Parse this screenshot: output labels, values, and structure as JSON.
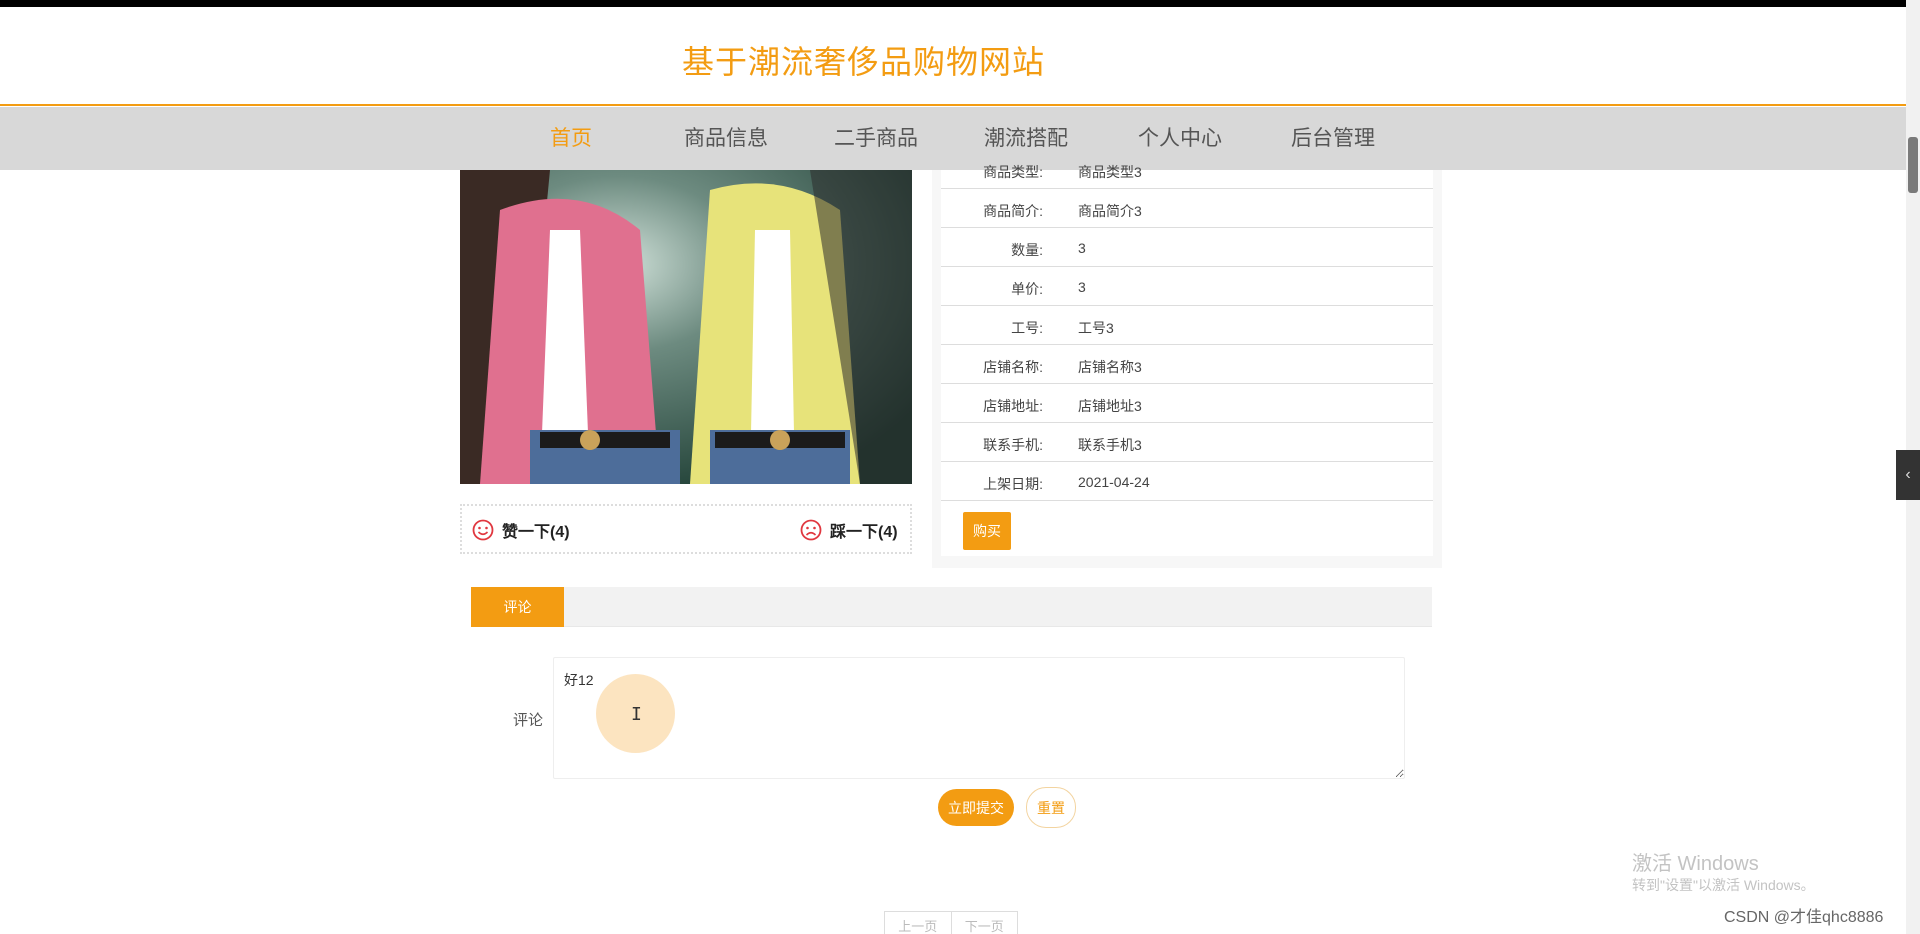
{
  "site": {
    "title": "基于潮流奢侈品购物网站"
  },
  "nav": {
    "items": [
      {
        "label": "首页",
        "active": true
      },
      {
        "label": "商品信息"
      },
      {
        "label": "二手商品"
      },
      {
        "label": "潮流搭配"
      },
      {
        "label": "个人中心"
      },
      {
        "label": "后台管理"
      }
    ]
  },
  "product": {
    "vote": {
      "like_label": "赞一下(4)",
      "dislike_label": "踩一下(4)"
    },
    "info": [
      {
        "label": "商品类型:",
        "value": "商品类型3"
      },
      {
        "label": "商品简介:",
        "value": "商品简介3"
      },
      {
        "label": "数量:",
        "value": "3"
      },
      {
        "label": "单价:",
        "value": "3"
      },
      {
        "label": "工号:",
        "value": "工号3"
      },
      {
        "label": "店铺名称:",
        "value": "店铺名称3"
      },
      {
        "label": "店铺地址:",
        "value": "店铺地址3"
      },
      {
        "label": "联系手机:",
        "value": "联系手机3"
      },
      {
        "label": "上架日期:",
        "value": "2021-04-24"
      }
    ],
    "buy_label": "购买"
  },
  "comments": {
    "tab_label": "评论",
    "field_label": "评论",
    "value": "好12",
    "submit_label": "立即提交",
    "reset_label": "重置"
  },
  "pager": {
    "prev": "上一页",
    "next": "下一页"
  },
  "overlay": {
    "watermark_title": "激活 Windows",
    "watermark_sub": "转到\"设置\"以激活 Windows。",
    "csdn": "CSDN @才佳qhc8886"
  },
  "colors": {
    "accent": "#f39c12",
    "nav_bg": "#d8d8d8"
  }
}
